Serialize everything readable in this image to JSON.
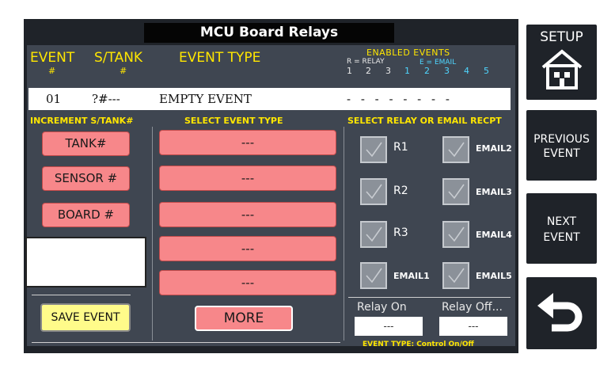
{
  "title": "MCU Board Relays",
  "headers": {
    "event": "EVENT",
    "event_hash": "#",
    "stank": "S/TANK",
    "stank_hash": "#",
    "event_type": "EVENT TYPE",
    "enabled_events": "ENABLED EVENTS",
    "r_legend": "R = RELAY",
    "e_legend": "E = EMAIL",
    "enabled_numbers": [
      "1",
      "2",
      "3",
      "1",
      "2",
      "3",
      "4",
      "5"
    ]
  },
  "event_row": {
    "number": "01",
    "stank": "?#---",
    "type": "EMPTY EVENT",
    "enabled": "- - - - - - - -"
  },
  "columns": {
    "increment": "INCREMENT S/TANK#",
    "select_type": "SELECT EVENT TYPE",
    "select_relay": "SELECT RELAY OR EMAIL RECPT"
  },
  "increment_buttons": [
    "TANK#",
    "SENSOR #",
    "BOARD #"
  ],
  "event_type_slots": [
    "---",
    "---",
    "---",
    "---",
    "---"
  ],
  "more_label": "MORE",
  "save_label": "SAVE EVENT",
  "recipients": {
    "left": [
      "R1",
      "R2",
      "R3",
      "EMAIL1"
    ],
    "right": [
      "EMAIL2",
      "EMAIL3",
      "EMAIL4",
      "EMAIL5"
    ]
  },
  "relay_on": {
    "label": "Relay On",
    "value": "---"
  },
  "relay_off": {
    "label": "Relay Off...",
    "value": "---"
  },
  "event_type_footer": "EVENT TYPE: Control On/Off",
  "side": {
    "setup": "SETUP",
    "previous_1": "PREVIOUS",
    "previous_2": "EVENT",
    "next_1": "NEXT",
    "next_2": "EVENT"
  },
  "colors": {
    "accent_yellow": "#ffe600",
    "accent_cyan": "#4fd6ff",
    "button_pink": "#f7878a",
    "save_yellow": "#fffb8a",
    "panel": "#3f4651"
  }
}
